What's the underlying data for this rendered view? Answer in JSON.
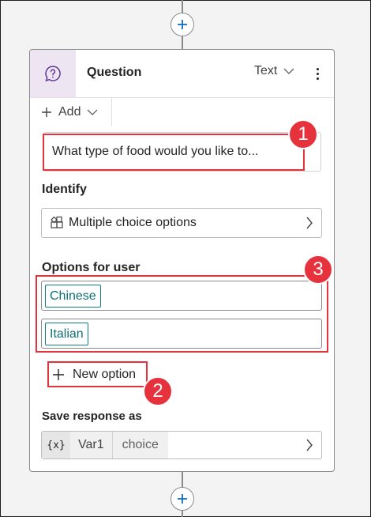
{
  "node": {
    "title": "Question",
    "type_label": "Text",
    "add_label": "Add",
    "question_text": "What type of food would you like to...",
    "identify_label": "Identify",
    "identify_value": "Multiple choice options",
    "options_label": "Options for user",
    "options": [
      "Chinese",
      "Italian"
    ],
    "new_option_label": "New option",
    "save_label": "Save response as",
    "var_icon": "{x}",
    "var_name": "Var1",
    "var_type": "choice"
  },
  "annotations": {
    "badge_1": "1",
    "badge_2": "2",
    "badge_3": "3",
    "color": "#e5323c"
  },
  "icons": {
    "header": "question-bubble-icon",
    "identify": "shapes-icon",
    "add": "plus-icon",
    "chevron": "chevron-down-icon",
    "more": "more-vertical-icon"
  }
}
